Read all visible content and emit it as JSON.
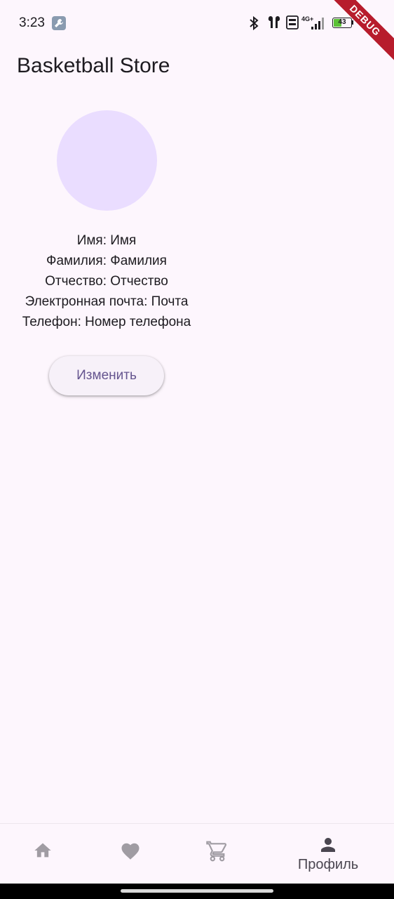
{
  "status_bar": {
    "time": "3:23",
    "network": "4G+",
    "battery_level": "43",
    "debug_label": "DEBUG"
  },
  "app_bar": {
    "title": "Basketball Store"
  },
  "profile": {
    "lines": [
      "Имя: Имя",
      "Фамилия: Фамилия",
      "Отчество: Отчество",
      "Электронная почта: Почта",
      "Телефон: Номер телефона"
    ],
    "edit_label": "Изменить"
  },
  "bottom_nav": {
    "items": [
      {
        "icon": "home-icon",
        "label": "",
        "active": false
      },
      {
        "icon": "heart-icon",
        "label": "",
        "active": false
      },
      {
        "icon": "cart-icon",
        "label": "",
        "active": false
      },
      {
        "icon": "person-icon",
        "label": "Профиль",
        "active": true
      }
    ]
  },
  "colors": {
    "background": "#fdf6fd",
    "avatar": "#eaddff",
    "button_text": "#65558f",
    "inactive_icon": "#a09ca3",
    "active_icon": "#4a4650"
  }
}
